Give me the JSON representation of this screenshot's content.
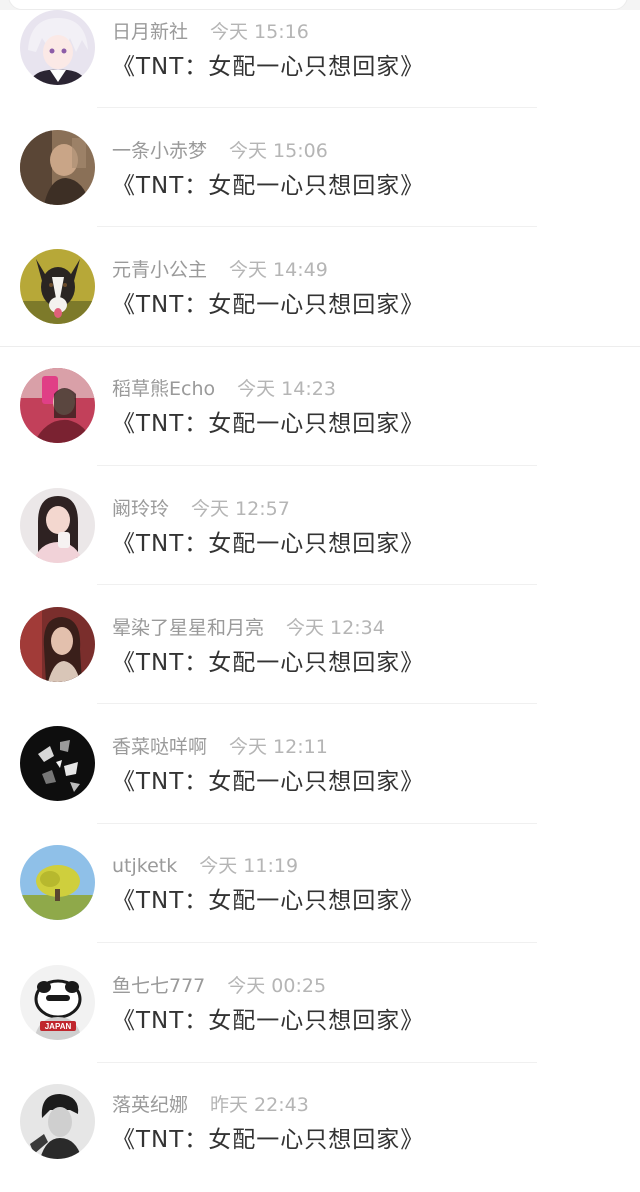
{
  "comments": [
    {
      "username": "日月新社",
      "time": "今天 15:16",
      "text": "《TNT：女配一心只想回家》",
      "avatar": "anime-avatar-icon"
    },
    {
      "username": "一条小赤梦",
      "time": "今天 15:06",
      "text": "《TNT：女配一心只想回家》",
      "avatar": "person-avatar-icon"
    },
    {
      "username": "元青小公主",
      "time": "今天 14:49",
      "text": "《TNT：女配一心只想回家》",
      "avatar": "dog-avatar-icon"
    },
    {
      "username": "稻草熊Echo",
      "time": "今天 14:23",
      "text": "《TNT：女配一心只想回家》",
      "avatar": "selfie-avatar-icon"
    },
    {
      "username": "阚玲玲",
      "time": "今天 12:57",
      "text": "《TNT：女配一心只想回家》",
      "avatar": "girl-avatar-icon"
    },
    {
      "username": "晕染了星星和月亮",
      "time": "今天 12:34",
      "text": "《TNT：女配一心只想回家》",
      "avatar": "portrait-avatar-icon"
    },
    {
      "username": "香菜哒咩啊",
      "time": "今天 12:11",
      "text": "《TNT：女配一心只想回家》",
      "avatar": "dark-avatar-icon"
    },
    {
      "username": "utjketk",
      "time": "今天 11:19",
      "text": "《TNT：女配一心只想回家》",
      "avatar": "tree-avatar-icon"
    },
    {
      "username": "鱼七七777",
      "time": "今天 00:25",
      "text": "《TNT：女配一心只想回家》",
      "avatar": "japan-character-avatar-icon",
      "avatar_text": "JAPAN"
    },
    {
      "username": "落英纪娜",
      "time": "昨天 22:43",
      "text": "《TNT：女配一心只想回家》",
      "avatar": "bw-portrait-avatar-icon"
    }
  ]
}
